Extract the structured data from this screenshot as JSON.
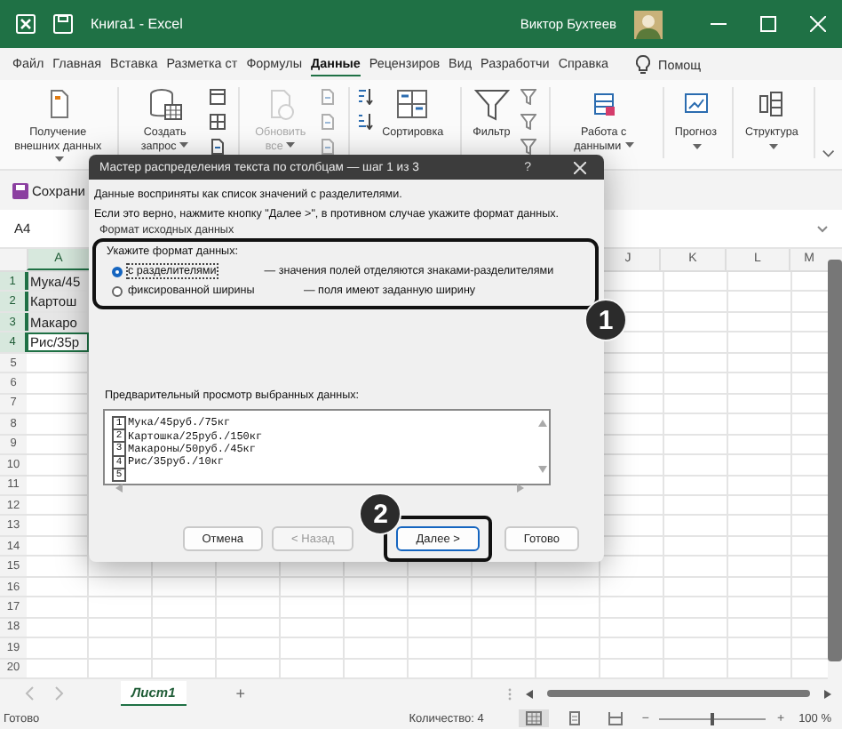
{
  "window": {
    "title": "Книга1 - Excel",
    "user": "Виктор Бухтеев"
  },
  "ribbon_tabs": [
    {
      "label": "Файл",
      "selected": false
    },
    {
      "label": "Главная",
      "selected": false
    },
    {
      "label": "Вставка",
      "selected": false
    },
    {
      "label": "Разметка ст",
      "selected": false
    },
    {
      "label": "Формулы",
      "selected": false
    },
    {
      "label": "Данные",
      "selected": true
    },
    {
      "label": "Рецензиров",
      "selected": false
    },
    {
      "label": "Вид",
      "selected": false
    },
    {
      "label": "Разработчи",
      "selected": false
    },
    {
      "label": "Справка",
      "selected": false
    }
  ],
  "help_search": {
    "placeholder": "Помощ"
  },
  "ribbon_groups": [
    {
      "kind": "get_data",
      "label": "Получение внешних данных",
      "dropdown": true,
      "caret_below": false,
      "disabled": false
    },
    {
      "kind": "query",
      "label": "Создать запрос",
      "dropdown": true,
      "caret_below": false,
      "disabled": false,
      "side_icons": [
        {
          "kind": "table"
        },
        {
          "kind": "grid"
        },
        {
          "kind": "doc"
        }
      ]
    },
    {
      "kind": "refresh",
      "label": "Обновить все",
      "dropdown": true,
      "caret_below": false,
      "disabled": true,
      "side_icons": [
        {
          "kind": "doc"
        },
        {
          "kind": "doc"
        },
        {
          "kind": "doc"
        }
      ]
    },
    {
      "kind": "sort",
      "label": "Сортировка",
      "dropdown": false,
      "disabled": false,
      "side_icons": [
        {
          "kind": "sort_down"
        },
        {
          "kind": "sort_up"
        }
      ]
    },
    {
      "kind": "filter",
      "label": "Фильтр",
      "dropdown": false,
      "disabled": false,
      "side_icons": [
        {
          "kind": "funnel"
        },
        {
          "kind": "funnel"
        },
        {
          "kind": "funnel"
        }
      ]
    },
    {
      "kind": "data_tools",
      "label": "Работа с данными",
      "dropdown": true,
      "caret_below": false,
      "disabled": false
    },
    {
      "kind": "forecast",
      "label": "Прогноз",
      "dropdown": true,
      "caret_below": true,
      "disabled": false
    },
    {
      "kind": "outline",
      "label": "Структура",
      "dropdown": true,
      "caret_below": true,
      "disabled": false
    }
  ],
  "quick_access": {
    "save_label": "Сохрани"
  },
  "name_box": "A4",
  "sheet": {
    "columns": [
      {
        "label": "A",
        "selected": true
      },
      {
        "label": "J",
        "selected": false
      },
      {
        "label": "K",
        "selected": false
      },
      {
        "label": "L",
        "selected": false
      },
      {
        "label": "M",
        "selected": false
      }
    ],
    "rows": [
      "1",
      "2",
      "3",
      "4",
      "5",
      "6",
      "7",
      "8",
      "9",
      "10",
      "11",
      "12",
      "13",
      "14",
      "15",
      "16",
      "17",
      "18",
      "19",
      "20"
    ],
    "cells": [
      {
        "text": "Мука/45",
        "selected": true,
        "active": false
      },
      {
        "text": "Картош",
        "selected": true,
        "active": false
      },
      {
        "text": "Макаро",
        "selected": true,
        "active": false
      },
      {
        "text": "Рис/35р",
        "selected": true,
        "active": true
      }
    ]
  },
  "dialog": {
    "title": "Мастер распределения текста по столбцам — шаг 1 из 3",
    "help": "?",
    "intro": [
      "Данные восприняты как список значений с разделителями.",
      "Если это верно, нажмите кнопку \"Далее >\", в противном случае укажите формат данных."
    ],
    "group_title": "Формат исходных данных",
    "format_prompt": "Укажите формат данных:",
    "options": [
      {
        "label": "с разделителями",
        "description": "— значения полей отделяются знаками-разделителями",
        "selected": true
      },
      {
        "label": "фиксированной ширины",
        "description": "— поля имеют заданную ширину",
        "selected": false
      }
    ],
    "preview_label": "Предварительный просмотр выбранных данных:",
    "preview_lines": [
      {
        "number": "1",
        "text": "Мука/45руб./75кг"
      },
      {
        "number": "2",
        "text": "Картошка/25руб./150кг"
      },
      {
        "number": "3",
        "text": "Макароны/50руб./45кг"
      },
      {
        "number": "4",
        "text": "Рис/35руб./10кг"
      },
      {
        "number": "5"
      }
    ],
    "buttons": [
      {
        "label": "Отмена",
        "disabled": false,
        "highlighted": false
      },
      {
        "label": "< Назад",
        "disabled": true,
        "highlighted": false
      },
      {
        "label": "Далее >",
        "disabled": false,
        "highlighted": true
      },
      {
        "label": "Готово",
        "disabled": false,
        "highlighted": false
      }
    ]
  },
  "callouts": [
    "1",
    "2"
  ],
  "sheet_tabs": [
    {
      "label": "Лист1",
      "selected": true
    }
  ],
  "add_sheet": "+",
  "status_bar": {
    "status": "Готово",
    "count": "Количество: 4",
    "views": [
      {
        "kind": "normal",
        "selected": true
      },
      {
        "kind": "page_layout",
        "selected": false
      },
      {
        "kind": "page_break",
        "selected": false
      }
    ],
    "zoom_out": "−",
    "zoom_slider": {
      "level": 0.5
    },
    "zoom_in": "+",
    "zoom": "100 %"
  }
}
